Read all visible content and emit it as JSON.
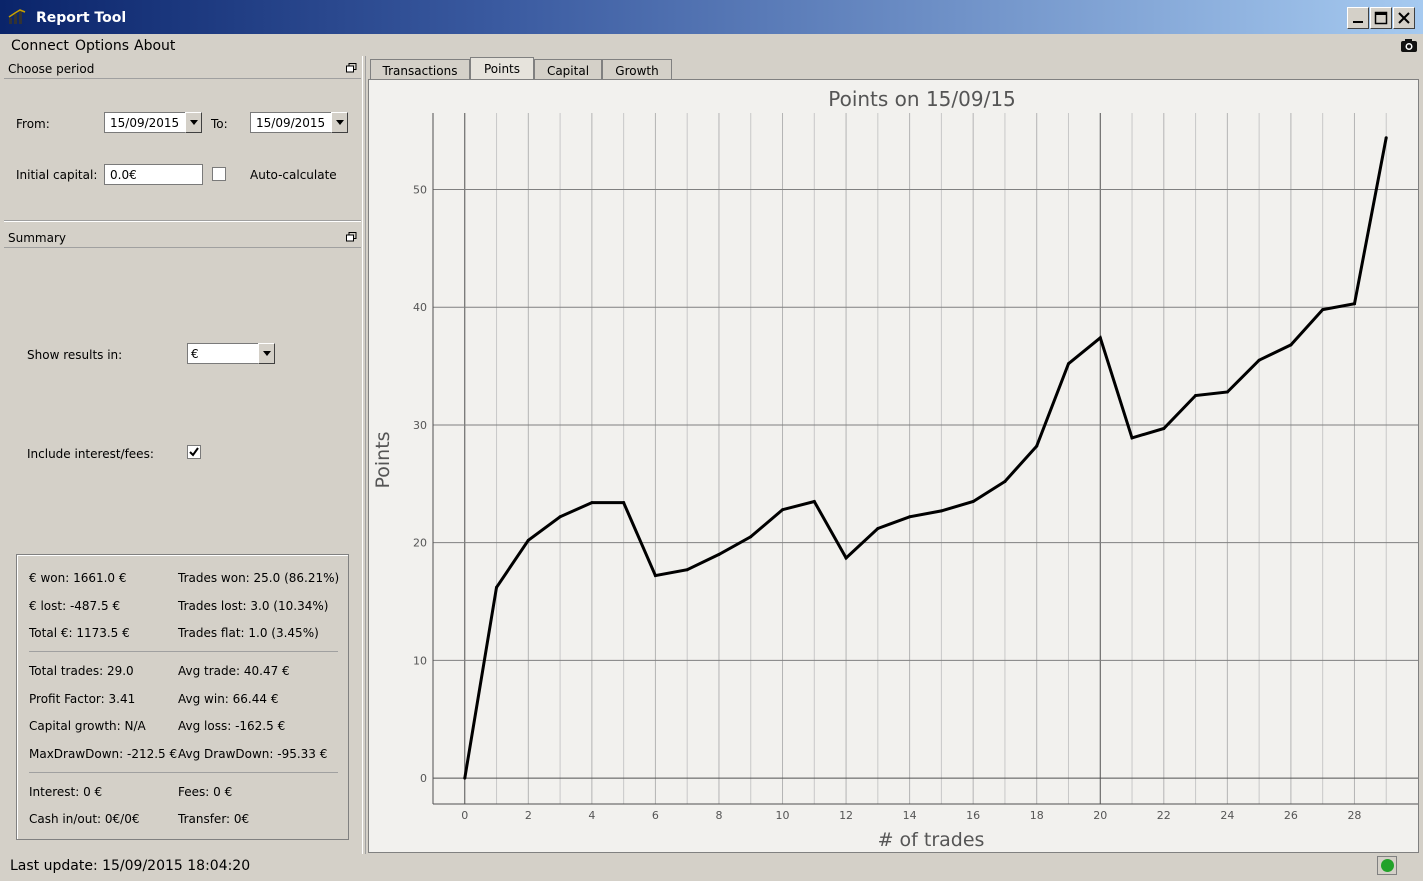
{
  "window": {
    "title": "Report Tool"
  },
  "menu": {
    "items": [
      "Connect",
      "Options",
      "About"
    ]
  },
  "period": {
    "title": "Choose period",
    "from_label": "From:",
    "from_value": "15/09/2015",
    "to_label": "To:",
    "to_value": "15/09/2015",
    "capital_label": "Initial capital:",
    "capital_value": "0.0€",
    "auto_label": "Auto-calculate"
  },
  "summary": {
    "title": "Summary",
    "show_label": "Show results in:",
    "show_value": "€",
    "interest_label": "Include interest/fees:",
    "interest_checked": true,
    "stats": {
      "won": "€ won: 1661.0 €",
      "trades_won": "Trades won: 25.0 (86.21%)",
      "lost": "€ lost: -487.5 €",
      "trades_lost": "Trades lost: 3.0 (10.34%)",
      "total": "Total €: 1173.5 €",
      "trades_flat": "Trades flat: 1.0 (3.45%)",
      "total_trades": "Total trades: 29.0",
      "avg_trade": "Avg trade: 40.47 €",
      "profit_factor": "Profit Factor: 3.41",
      "avg_win": "Avg win: 66.44 €",
      "capital_growth": "Capital growth: N/A",
      "avg_loss": "Avg loss: -162.5 €",
      "max_dd": "MaxDrawDown: -212.5 €",
      "avg_dd": "Avg DrawDown: -95.33 €",
      "interest": "Interest: 0 €",
      "fees": "Fees: 0 €",
      "cash": "Cash in/out: 0€/0€",
      "transfer": "Transfer: 0€"
    }
  },
  "tabs": [
    "Transactions",
    "Points",
    "Capital",
    "Growth"
  ],
  "active_tab": "Points",
  "status": {
    "last_update": "Last update: 15/09/2015 18:04:20",
    "connection_color": "#22a22a"
  },
  "chart_data": {
    "type": "line",
    "title": "Points on 15/09/15",
    "xlabel": "# of trades",
    "ylabel": "Points",
    "xlim": [
      -1,
      30
    ],
    "ylim": [
      -2.2,
      56.5
    ],
    "x_ticks": [
      0,
      2,
      4,
      6,
      8,
      10,
      12,
      14,
      16,
      18,
      20,
      22,
      24,
      26,
      28
    ],
    "y_ticks": [
      0,
      10,
      20,
      30,
      40,
      50
    ],
    "grid": true,
    "x": [
      0,
      1,
      2,
      3,
      4,
      5,
      6,
      7,
      8,
      9,
      10,
      11,
      12,
      13,
      14,
      15,
      16,
      17,
      18,
      19,
      20,
      21,
      22,
      23,
      24,
      25,
      26,
      27,
      28,
      29
    ],
    "values": [
      0,
      16.2,
      20.2,
      22.2,
      23.4,
      23.4,
      17.2,
      17.7,
      19.0,
      20.5,
      22.8,
      23.5,
      18.7,
      21.2,
      22.2,
      22.7,
      23.5,
      25.2,
      28.2,
      35.2,
      37.4,
      28.9,
      29.7,
      32.5,
      32.8,
      35.5,
      36.8,
      39.8,
      40.3,
      54.4
    ]
  }
}
